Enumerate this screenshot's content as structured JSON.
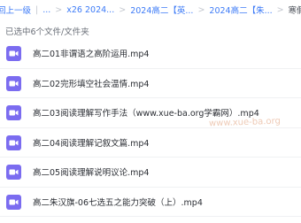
{
  "breadcrumb": {
    "items": [
      "回上一级",
      "...",
      "x26 2024...",
      "2024高二【英...",
      "2024高二【朱...",
      "寒假班"
    ]
  },
  "selection_info": "已选中6个文件/文件夹",
  "files": [
    {
      "name": "高二01非谓语之高阶运用.mp4",
      "icon": "video-file-icon"
    },
    {
      "name": "高二02完形填空社会温情.mp4",
      "icon": "video-file-icon"
    },
    {
      "name": "高二03阅读理解写作手法（www.xue-ba.org学霸网）.mp4",
      "icon": "video-file-icon"
    },
    {
      "name": "高二04阅读理解记叙文篇.mp4",
      "icon": "video-file-icon"
    },
    {
      "name": "高二05阅读理解说明议论.mp4",
      "icon": "video-file-icon"
    },
    {
      "name": "高二朱汉旗-06七选五之能力突破（上）.mp4",
      "icon": "video-file-icon"
    }
  ],
  "watermark": "www.xue-ba.org",
  "colors": {
    "link": "#3d7bf7",
    "video_icon": "#7b6cf0"
  }
}
